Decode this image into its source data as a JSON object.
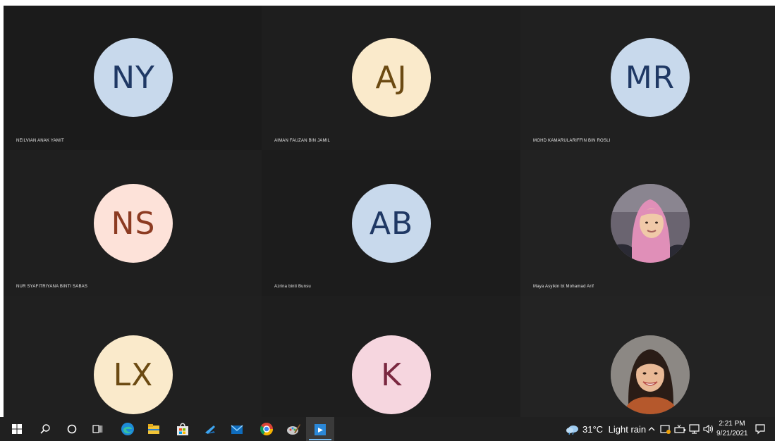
{
  "participants": [
    {
      "name": "NEILVIAN ANAK YAMIT",
      "initials": "NY",
      "avatar_bg": "#c8d9ec",
      "initials_color": "#1f3864",
      "type": "initials"
    },
    {
      "name": "AIMAN FAUZAN BIN JAMIL",
      "initials": "AJ",
      "avatar_bg": "#faeacb",
      "initials_color": "#6b4a12",
      "type": "initials"
    },
    {
      "name": "MOHD KAMARULARIFFIN BIN ROSLI",
      "initials": "MR",
      "avatar_bg": "#c8d9ec",
      "initials_color": "#1f3864",
      "type": "initials"
    },
    {
      "name": "NUR SYAFITRIYANA BINTI SABAS",
      "initials": "NS",
      "avatar_bg": "#fde2d9",
      "initials_color": "#8c3b22",
      "type": "initials"
    },
    {
      "name": "Azrina binti Bunsu",
      "initials": "AB",
      "avatar_bg": "#c8d9ec",
      "initials_color": "#1f3864",
      "type": "initials"
    },
    {
      "name": "Maya Asyikin bt Mohamad Arif",
      "initials": "",
      "avatar_bg": "#8a7a80",
      "initials_color": "#ffffff",
      "type": "photo"
    },
    {
      "name": "",
      "initials": "LX",
      "avatar_bg": "#faeacb",
      "initials_color": "#6b4a12",
      "type": "initials"
    },
    {
      "name": "",
      "initials": "K",
      "avatar_bg": "#f6d6df",
      "initials_color": "#7a2840",
      "type": "initials"
    },
    {
      "name": "",
      "initials": "",
      "avatar_bg": "#6e6a66",
      "initials_color": "#ffffff",
      "type": "photo"
    }
  ],
  "taskbar": {
    "apps": [
      {
        "icon": "windows-start-icon",
        "active": false
      },
      {
        "icon": "search-icon",
        "active": false
      },
      {
        "icon": "cortana-icon",
        "active": false
      },
      {
        "icon": "task-view-icon",
        "active": false
      },
      {
        "icon": "edge-icon",
        "active": false
      },
      {
        "icon": "file-explorer-icon",
        "active": false
      },
      {
        "icon": "store-icon",
        "active": false
      },
      {
        "icon": "app-arrow-icon",
        "active": false
      },
      {
        "icon": "mail-icon",
        "active": false
      },
      {
        "icon": "chrome-icon",
        "active": false
      },
      {
        "icon": "paint-icon",
        "active": false
      },
      {
        "icon": "teams-icon",
        "active": true
      }
    ],
    "weather": {
      "temp": "31°C",
      "condition": "Light rain"
    },
    "clock": {
      "time": "2:21 PM",
      "date": "9/21/2021"
    }
  },
  "colors": {
    "accent": "#76b9ed",
    "tile_bg": "#1b1b1b",
    "taskbar_bg": "#202020"
  }
}
